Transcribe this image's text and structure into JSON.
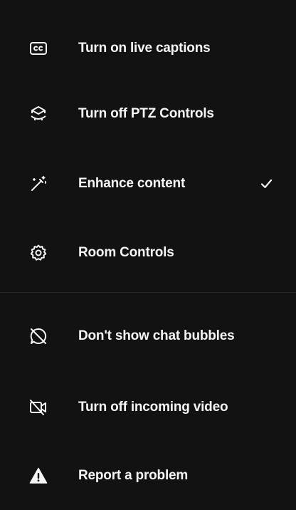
{
  "menu": {
    "items": [
      {
        "label": "Turn on live captions",
        "icon": "closed-captions-icon",
        "checked": false
      },
      {
        "label": "Turn off PTZ Controls",
        "icon": "ptz-camera-icon",
        "checked": false
      },
      {
        "label": "Enhance content",
        "icon": "magic-wand-icon",
        "checked": true
      },
      {
        "label": "Room Controls",
        "icon": "gear-icon",
        "checked": false
      },
      {
        "label": "Don't show chat bubbles",
        "icon": "chat-bubble-off-icon",
        "checked": false
      },
      {
        "label": "Turn off incoming video",
        "icon": "video-off-icon",
        "checked": false
      },
      {
        "label": "Report a problem",
        "icon": "warning-icon",
        "checked": false
      }
    ]
  },
  "colors": {
    "background": "#121212",
    "text": "#f5f5f5",
    "divider": "#262626"
  }
}
